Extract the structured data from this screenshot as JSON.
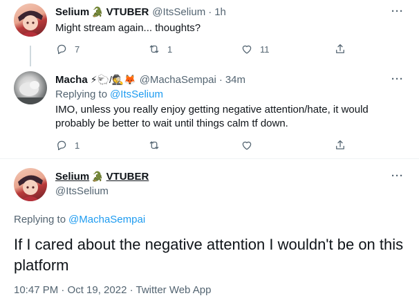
{
  "tweet1": {
    "name": "Selium",
    "name_suffix": "VTUBER",
    "name_emoji": "🐊",
    "handle": "@ItsSelium",
    "dot": "·",
    "time": "1h",
    "text": "Might stream again... thoughts?",
    "replies": "7",
    "retweets": "1",
    "likes": "11"
  },
  "tweet2": {
    "name": "Macha",
    "name_emojis": "⚡🐑/🕵🦊",
    "handle": "@MachaSempai",
    "dot": "·",
    "time": "34m",
    "replying_label": "Replying to",
    "replying_to": "@ItsSelium",
    "text": "IMO, unless you really enjoy getting negative attention/hate, it would probably be better to wait until things calm tf down.",
    "replies": "1"
  },
  "main": {
    "name": "Selium",
    "name_suffix": "VTUBER",
    "name_emoji": "🐊",
    "handle": "@ItsSelium",
    "replying_label": "Replying to",
    "replying_to": "@MachaSempai",
    "text": "If I cared about the negative attention I wouldn't be on this platform",
    "meta": "10:47 PM · Oct 19, 2022 · Twitter Web App"
  },
  "more_glyph": "···",
  "icons": [
    "reply-icon",
    "retweet-icon",
    "like-icon",
    "share-icon",
    "more-icon"
  ]
}
